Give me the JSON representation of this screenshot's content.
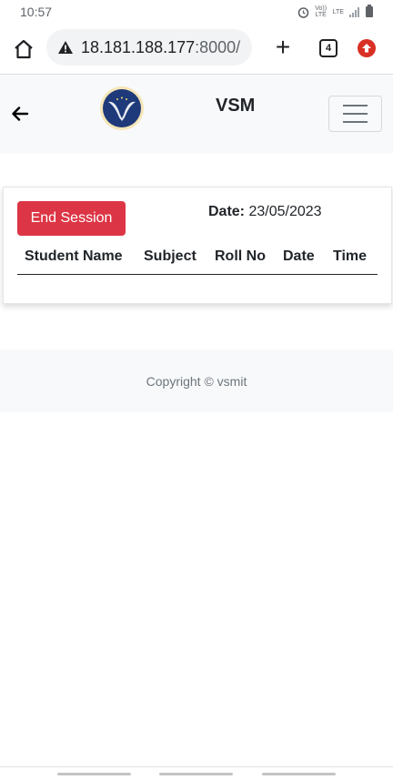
{
  "status_bar": {
    "time": "10:57",
    "volte_label": "Vo)) LTE",
    "lte_label": "LTE"
  },
  "browser": {
    "url_host": "18.181.188.177",
    "url_port": ":8000/",
    "tab_count": "4"
  },
  "app_nav": {
    "brand": "VSM",
    "logo_letter": "V"
  },
  "session": {
    "end_button_label": "End Session",
    "date_label": "Date:",
    "date_value": "23/05/2023",
    "columns": [
      "Student Name",
      "Subject",
      "Roll No",
      "Date",
      "Time"
    ],
    "rows": []
  },
  "footer": {
    "copyright": "Copyright © vsmit"
  },
  "colors": {
    "danger": "#dc3545",
    "nav_bg": "#f8f9fa",
    "logo_navy": "#1e3a7a"
  }
}
